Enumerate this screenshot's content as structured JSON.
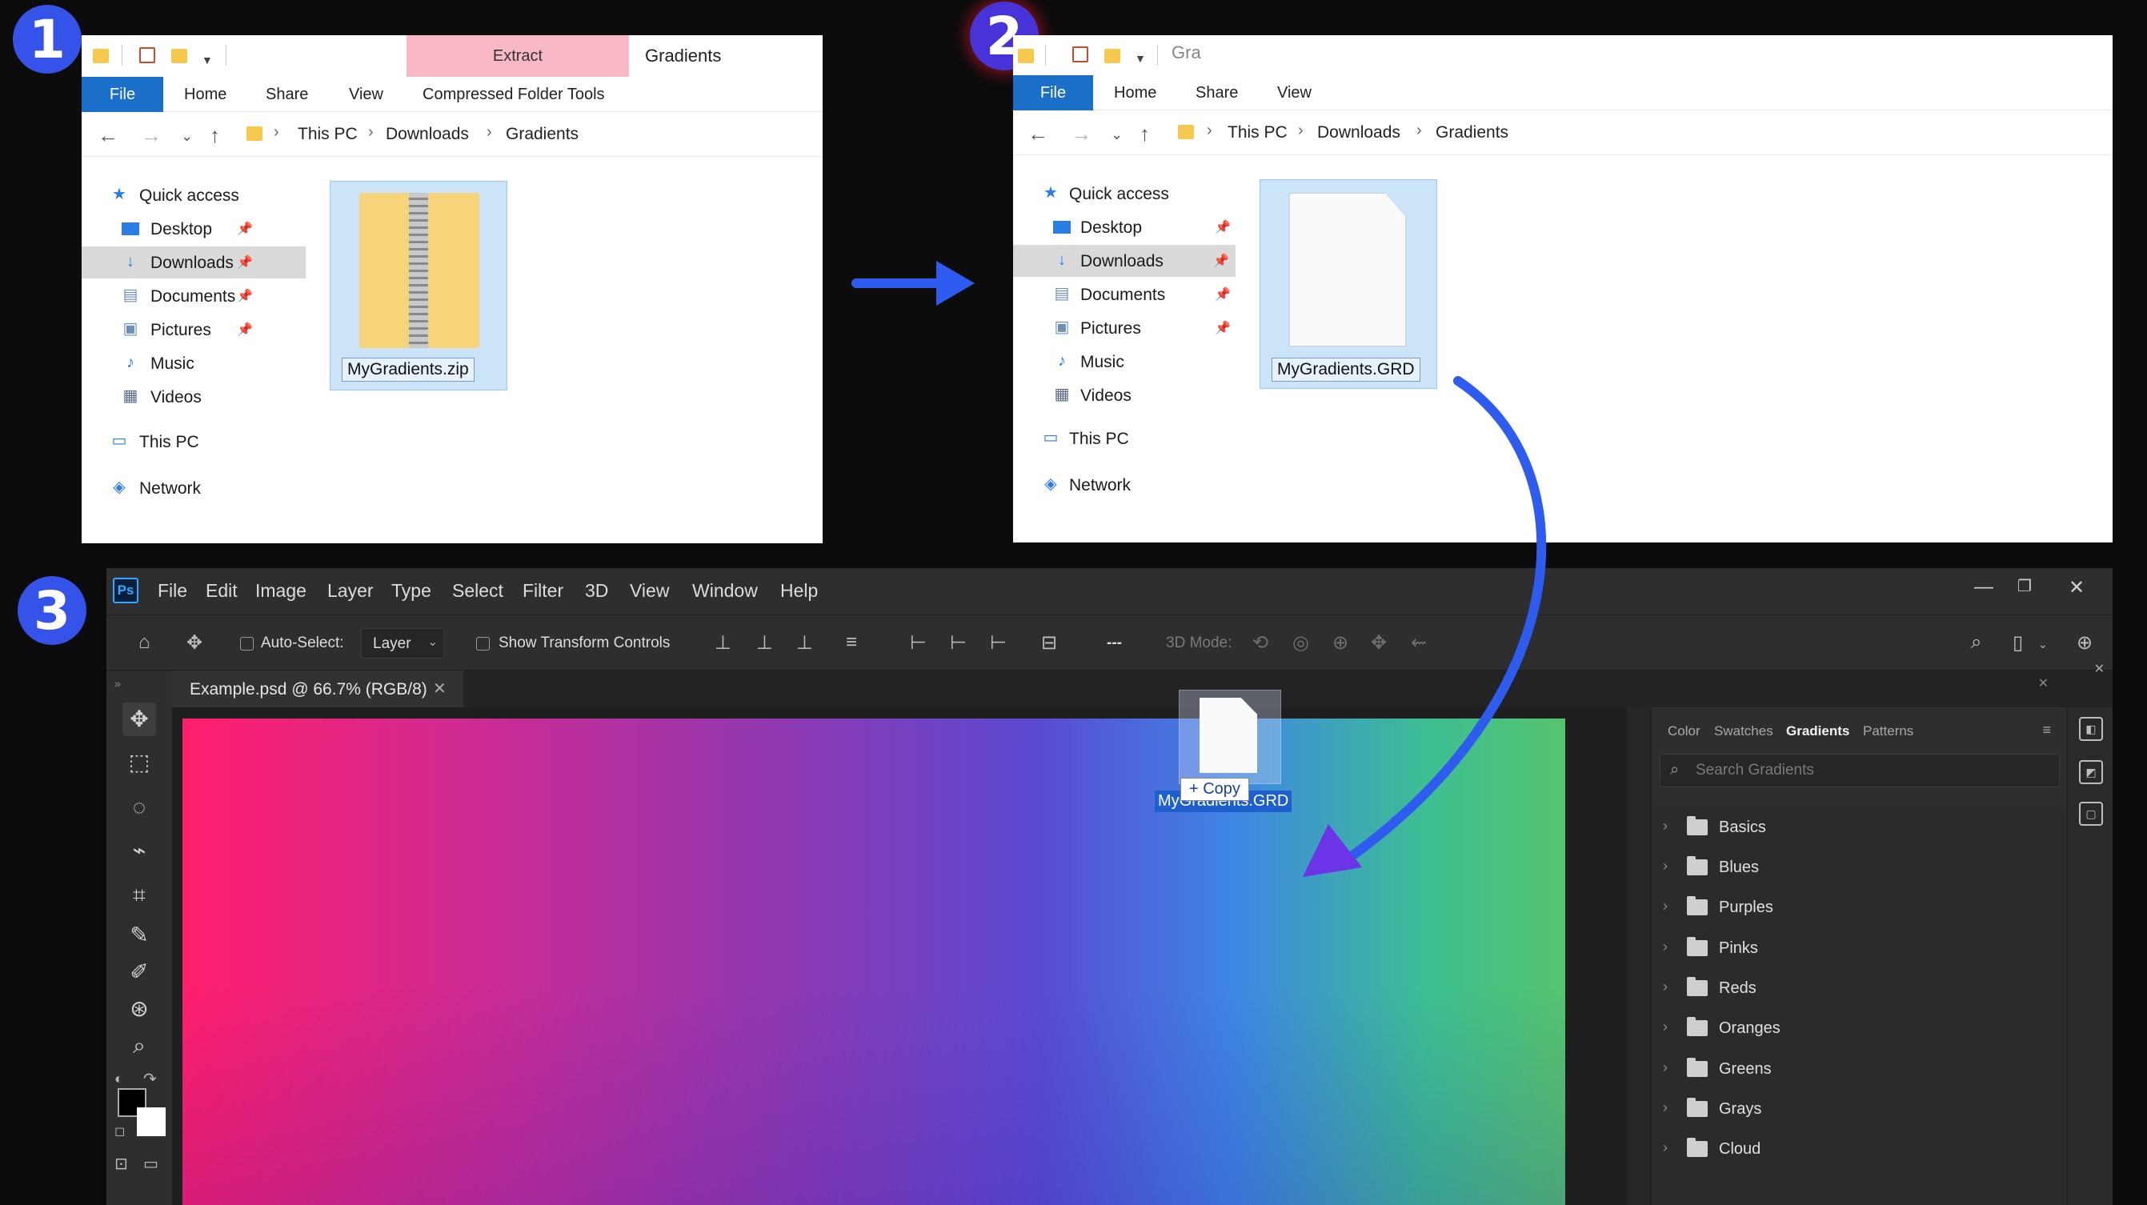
{
  "steps": {
    "one": "1",
    "two": "2",
    "three": "3"
  },
  "explorer1": {
    "ribbon_tabs": [
      "File",
      "Home",
      "Share",
      "View",
      "Compressed Folder Tools"
    ],
    "extract_tab": "Extract",
    "context_title": "Gradients",
    "breadcrumb": [
      "This PC",
      "Downloads",
      "Gradients"
    ],
    "nav": [
      "Quick access",
      "Desktop",
      "Downloads",
      "Documents",
      "Pictures",
      "Music",
      "Videos",
      "This PC",
      "Network"
    ],
    "file_name": "MyGradients.zip"
  },
  "explorer2": {
    "title_partial": "Gra",
    "ribbon_tabs": [
      "File",
      "Home",
      "Share",
      "View"
    ],
    "breadcrumb": [
      "This PC",
      "Downloads",
      "Gradients"
    ],
    "nav": [
      "Quick access",
      "Desktop",
      "Downloads",
      "Documents",
      "Pictures",
      "Music",
      "Videos",
      "This PC",
      "Network"
    ],
    "file_name": "MyGradients.GRD"
  },
  "photoshop": {
    "logo": "Ps",
    "menus": [
      "File",
      "Edit",
      "Image",
      "Layer",
      "Type",
      "Select",
      "Filter",
      "3D",
      "View",
      "Window",
      "Help"
    ],
    "options": {
      "auto_select": "Auto-Select:",
      "layer_value": "Layer",
      "show_transform": "Show Transform Controls",
      "mode_3d": "3D Mode:",
      "more": "---"
    },
    "doc_tab": "Example.psd @ 66.7% (RGB/8)",
    "panel_tabs": [
      "Color",
      "Swatches",
      "Gradients",
      "Patterns"
    ],
    "search_placeholder": "Search Gradients",
    "gradient_folders": [
      "Basics",
      "Blues",
      "Purples",
      "Pinks",
      "Reds",
      "Oranges",
      "Greens",
      "Grays",
      "Cloud"
    ],
    "drag_filename": "MyGradients.GRD",
    "copy_label": "+ Copy"
  },
  "colors": {
    "accent_blue": "#1a6fc9",
    "badge_blue": "#3553e8",
    "arrow_blue": "#2f5cf0",
    "extract_pink": "#f9b8c6"
  },
  "icons": [
    "folder-icon",
    "checkmark-icon",
    "pin-icon",
    "star-icon",
    "download-arrow-icon",
    "search-icon",
    "move-tool-icon"
  ]
}
